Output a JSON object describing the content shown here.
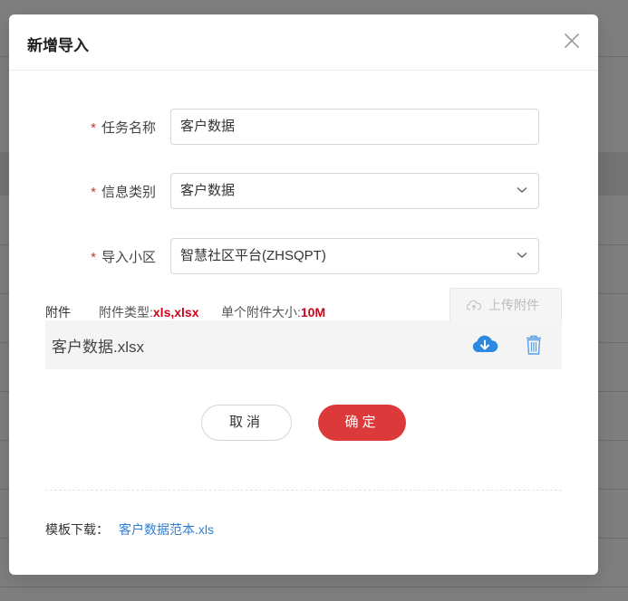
{
  "modal": {
    "title": "新增导入"
  },
  "form": {
    "required_mark": "*",
    "task_name": {
      "label": "任务名称",
      "value": "客户数据"
    },
    "info_type": {
      "label": "信息类别",
      "value": "客户数据"
    },
    "community": {
      "label": "导入小区",
      "value": "智慧社区平台(ZHSQPT)"
    }
  },
  "attachment": {
    "label": "附件",
    "type_prefix": "附件类型:",
    "type_value": "xls,xlsx",
    "size_prefix": "单个附件大小:",
    "size_value": "10M",
    "upload_label": "上传附件",
    "files": [
      {
        "name": "客户数据.xlsx"
      }
    ]
  },
  "actions": {
    "cancel_label": "取消",
    "confirm_label": "确定"
  },
  "template": {
    "label": "模板下载：",
    "link_text": "客户数据范本.xls"
  },
  "colors": {
    "primary_red": "#dc3a3a",
    "link_blue": "#2f7fd1",
    "required_red": "#c0392b",
    "download_blue": "#2b8ae0"
  },
  "icons": {
    "close": "close-icon",
    "select_arrow": "chevron-down-icon",
    "upload": "cloud-upload-icon",
    "download": "cloud-download-icon",
    "delete": "trash-icon"
  }
}
